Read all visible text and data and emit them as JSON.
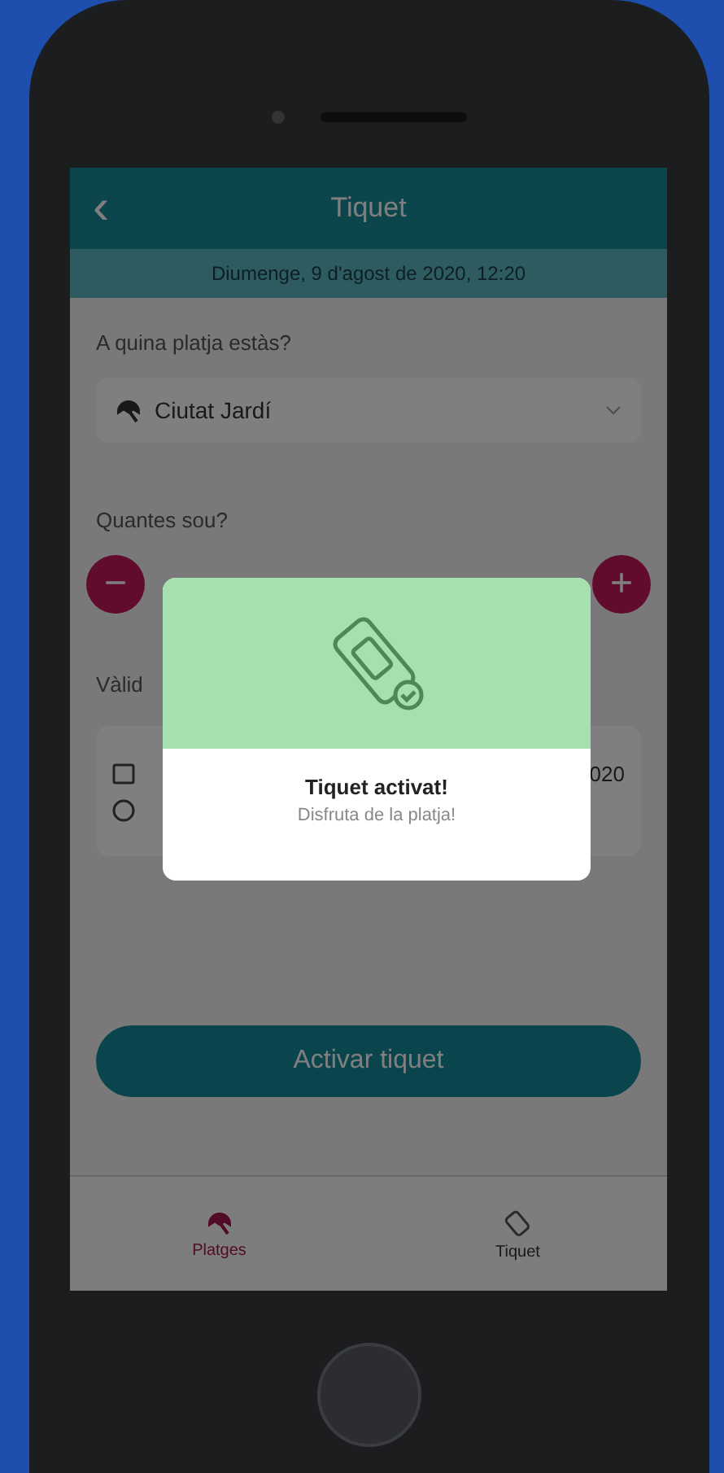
{
  "header": {
    "back": "‹",
    "title": "Tiquet",
    "subtitle": "Diumenge, 9 d'agost de 2020, 12:20"
  },
  "beach": {
    "label": "A quina platja estàs?",
    "value": "Ciutat Jardí"
  },
  "quantity": {
    "label": "Quantes sou?",
    "minus": "−",
    "plus": "+"
  },
  "validity": {
    "label": "Vàlid",
    "date_tail": "020"
  },
  "activate_button": "Activar tiquet",
  "modal": {
    "title": "Tiquet activat!",
    "message": "Disfruta de la platja!"
  },
  "tabs": [
    {
      "label": "Platges",
      "kind": "beaches",
      "selected": true
    },
    {
      "label": "Tiquet",
      "kind": "ticket",
      "selected": false
    }
  ]
}
